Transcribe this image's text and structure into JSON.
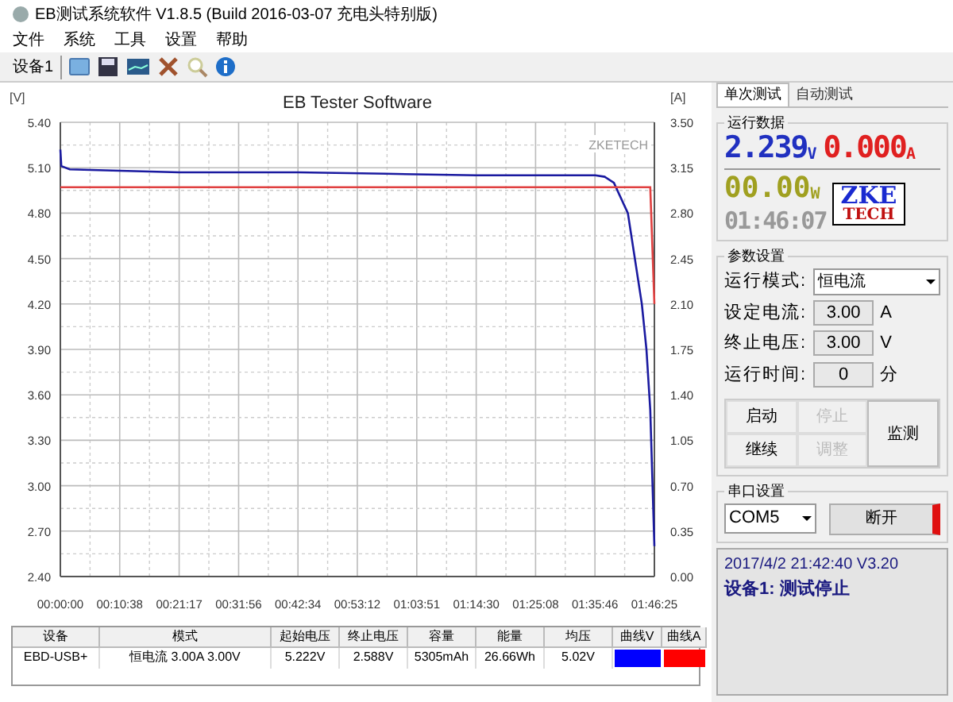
{
  "window": {
    "title": "EB测试系统软件 V1.8.5 (Build 2016-03-07 充电头特别版)"
  },
  "menu": [
    "文件",
    "系统",
    "工具",
    "设置",
    "帮助"
  ],
  "toolbar": {
    "device_label": "设备1"
  },
  "chart": {
    "watermark": "ZKETECH",
    "y_unit": "[V]",
    "y2_unit": "[A]",
    "chart_data": {
      "type": "line",
      "title": "EB Tester Software",
      "grid": true,
      "xlim": [
        0,
        6385
      ],
      "ylim": [
        2.4,
        5.4
      ],
      "y2lim": [
        0,
        3.5
      ],
      "xticks": [
        {
          "value": 0,
          "label": "00:00:00"
        },
        {
          "value": 638,
          "label": "00:10:38"
        },
        {
          "value": 1277,
          "label": "00:21:17"
        },
        {
          "value": 1916,
          "label": "00:31:56"
        },
        {
          "value": 2554,
          "label": "00:42:34"
        },
        {
          "value": 3192,
          "label": "00:53:12"
        },
        {
          "value": 3831,
          "label": "01:03:51"
        },
        {
          "value": 4470,
          "label": "01:14:30"
        },
        {
          "value": 5108,
          "label": "01:25:08"
        },
        {
          "value": 5746,
          "label": "01:35:46"
        },
        {
          "value": 6385,
          "label": "01:46:25"
        }
      ],
      "yticks": [
        {
          "value": 5.4,
          "label": "5.40"
        },
        {
          "value": 5.1,
          "label": "5.10"
        },
        {
          "value": 4.8,
          "label": "4.80"
        },
        {
          "value": 4.5,
          "label": "4.50"
        },
        {
          "value": 4.2,
          "label": "4.20"
        },
        {
          "value": 3.9,
          "label": "3.90"
        },
        {
          "value": 3.6,
          "label": "3.60"
        },
        {
          "value": 3.3,
          "label": "3.30"
        },
        {
          "value": 3.0,
          "label": "3.00"
        },
        {
          "value": 2.7,
          "label": "2.70"
        },
        {
          "value": 2.4,
          "label": "2.40"
        }
      ],
      "y2ticks": [
        {
          "value": 3.5,
          "label": "3.50"
        },
        {
          "value": 3.15,
          "label": "3.15"
        },
        {
          "value": 2.8,
          "label": "2.80"
        },
        {
          "value": 2.45,
          "label": "2.45"
        },
        {
          "value": 2.1,
          "label": "2.10"
        },
        {
          "value": 1.75,
          "label": "1.75"
        },
        {
          "value": 1.4,
          "label": "1.40"
        },
        {
          "value": 1.05,
          "label": "1.05"
        },
        {
          "value": 0.7,
          "label": "0.70"
        },
        {
          "value": 0.35,
          "label": "0.35"
        },
        {
          "value": 0,
          "label": "0.00"
        }
      ],
      "x": [
        0,
        10,
        100,
        638,
        1277,
        2554,
        3500,
        4470,
        5300,
        5750,
        5850,
        5950,
        6100,
        6250,
        6300,
        6340,
        6385
      ],
      "series": [
        {
          "name": "曲线V",
          "color": "#1a1aa0",
          "values": [
            5.22,
            5.11,
            5.09,
            5.08,
            5.07,
            5.07,
            5.06,
            5.05,
            5.05,
            5.05,
            5.04,
            5.0,
            4.8,
            4.2,
            3.9,
            3.5,
            2.6
          ]
        },
        {
          "name": "曲线A",
          "axis": "y2",
          "color": "#e04040",
          "values": [
            3.0,
            3.0,
            3.0,
            3.0,
            3.0,
            3.0,
            3.0,
            3.0,
            3.0,
            3.0,
            3.0,
            3.0,
            3.0,
            3.0,
            3.0,
            3.0,
            2.1
          ]
        }
      ]
    }
  },
  "table": {
    "columns": [
      "设备",
      "模式",
      "起始电压",
      "终止电压",
      "容量",
      "能量",
      "均压"
    ],
    "rows": [
      {
        "cells": [
          "EBD-USB+",
          "恒电流 3.00A 3.00V",
          "5.222V",
          "2.588V",
          "5305mAh",
          "26.66Wh",
          "5.02V"
        ],
        "swatches": [
          {
            "color": "#0000ff"
          },
          {
            "color": "#ff0000"
          }
        ]
      }
    ]
  },
  "tabs": [
    {
      "label": "单次测试",
      "selected": true
    },
    {
      "label": "自动测试",
      "selected": false
    }
  ],
  "run_data": {
    "title": "运行数据",
    "voltage": "2.239",
    "voltage_unit": "V",
    "current": "0.000",
    "current_unit": "A",
    "power": "00.00",
    "power_unit": "W",
    "time": "01:46:07",
    "logo_top": "ZKE",
    "logo_bottom": "TECH"
  },
  "params": {
    "title": "参数设置",
    "mode_label": "运行模式:",
    "mode_value": "恒电流",
    "fields": [
      {
        "label": "设定电流:",
        "value": "3.00",
        "unit": "A"
      },
      {
        "label": "终止电压:",
        "value": "3.00",
        "unit": "V"
      },
      {
        "label": "运行时间:",
        "value": "0",
        "unit": "分"
      }
    ],
    "buttons": [
      {
        "label": "启动",
        "disabled": false
      },
      {
        "label": "停止",
        "disabled": true
      },
      {
        "label": "继续",
        "disabled": false
      },
      {
        "label": "调整",
        "disabled": true
      }
    ],
    "monitor_button": "监测"
  },
  "serial": {
    "title": "串口设置",
    "port": "COM5",
    "button": "断开",
    "connected": true
  },
  "status": {
    "line1": "2017/4/2 21:42:40  V3.20",
    "line2": "设备1: 测试停止"
  }
}
